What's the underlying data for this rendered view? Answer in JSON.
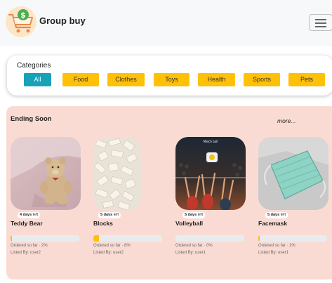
{
  "header": {
    "brand": "Group buy",
    "logo_icon": "shopping-cart-dollar-icon",
    "menu_icon": "hamburger-menu-icon"
  },
  "categories": {
    "title": "Categories",
    "items": [
      {
        "label": "All",
        "active": true
      },
      {
        "label": "Food",
        "active": false
      },
      {
        "label": "Clothes",
        "active": false
      },
      {
        "label": "Toys",
        "active": false
      },
      {
        "label": "Health",
        "active": false
      },
      {
        "label": "Sports",
        "active": false
      },
      {
        "label": "Pets",
        "active": false
      }
    ]
  },
  "ending_soon": {
    "title": "Ending Soon",
    "more_label": "more...",
    "products": [
      {
        "name": "Teddy Bear",
        "days": "4 days",
        "left": "left",
        "ordered": "Ordered so far · 2%",
        "progress": 0.02,
        "listed": "Listed By: user2"
      },
      {
        "name": "Blocks",
        "days": "5 days",
        "left": "left",
        "ordered": "Ordered so far · 8%",
        "progress": 0.08,
        "listed": "Listed By: user2"
      },
      {
        "name": "Volleyball",
        "days": "5 days",
        "left": "left",
        "ordered": "Ordered so far · 0%",
        "progress": 0.0,
        "listed": "Listed By: user1"
      },
      {
        "name": "Facemask",
        "days": "5 days",
        "left": "left",
        "ordered": "Ordered so far · 1%",
        "progress": 0.01,
        "listed": "Listed By: user1"
      }
    ]
  },
  "colors": {
    "category_active": "#17a2b8",
    "category_inactive": "#ffc107",
    "ending_bg": "#fadbd3",
    "progress_fill": "#ffc107"
  }
}
